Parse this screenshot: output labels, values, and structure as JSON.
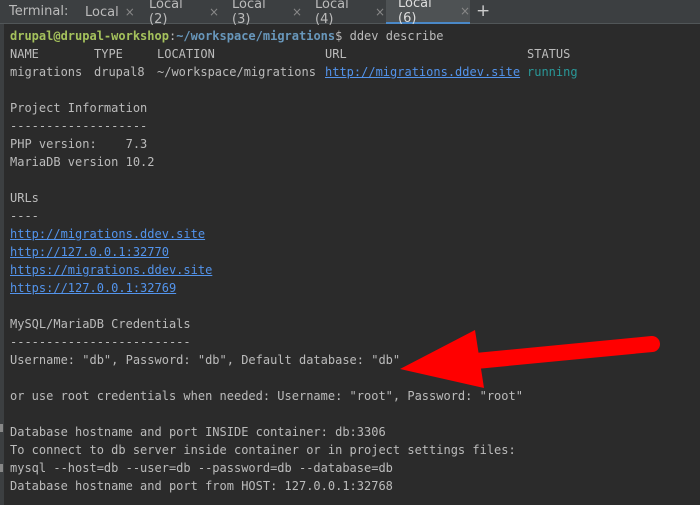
{
  "tabbar": {
    "label": "Terminal:",
    "tabs": [
      {
        "label": "Local"
      },
      {
        "label": "Local (2)"
      },
      {
        "label": "Local (3)"
      },
      {
        "label": "Local (4)"
      },
      {
        "label": "Local (6)"
      }
    ],
    "add_label": "+",
    "close_glyph": "×"
  },
  "terminal": {
    "prompt_user": "drupal@drupal-workshop",
    "prompt_sep": ":",
    "prompt_path": "~/workspace/migrations",
    "prompt_symbol": "$ ",
    "command": "ddev describe",
    "headers": [
      "NAME",
      "TYPE",
      "LOCATION",
      "URL",
      "STATUS"
    ],
    "row": {
      "name": "migrations",
      "type": "drupal8",
      "location": "~/workspace/migrations",
      "url": "http://migrations.ddev.site",
      "status": "running"
    },
    "project_info_title": "Project Information",
    "project_info_rule": "-------------------",
    "php_version": "PHP version:    7.3",
    "mariadb_version": "MariaDB version 10.2",
    "urls_title": "URLs",
    "urls_rule": "----",
    "urls": [
      "http://migrations.ddev.site",
      "http://127.0.0.1:32770",
      "https://migrations.ddev.site",
      "https://127.0.0.1:32769"
    ],
    "creds_title": "MySQL/MariaDB Credentials",
    "creds_rule": "-------------------------",
    "creds_line": "Username: \"db\", Password: \"db\", Default database: \"db\"",
    "root_creds_line": "or use root credentials when needed: Username: \"root\", Password: \"root\"",
    "db_inside_line": "Database hostname and port INSIDE container: db:3306",
    "connect_line": "To connect to db server inside container or in project settings files:",
    "mysql_cmd_line": "mysql --host=db --user=db --password=db --database=db",
    "db_host_line": "Database hostname and port from HOST: 127.0.0.1:32768"
  },
  "annotation": {
    "arrow_color": "#ff0000"
  },
  "colors": {
    "background": "#2b2b2b",
    "text": "#bbbbbb",
    "prompt_user": "#a5c25c",
    "prompt_path": "#6897bb",
    "link": "#5394ec",
    "status_running": "#299999"
  }
}
